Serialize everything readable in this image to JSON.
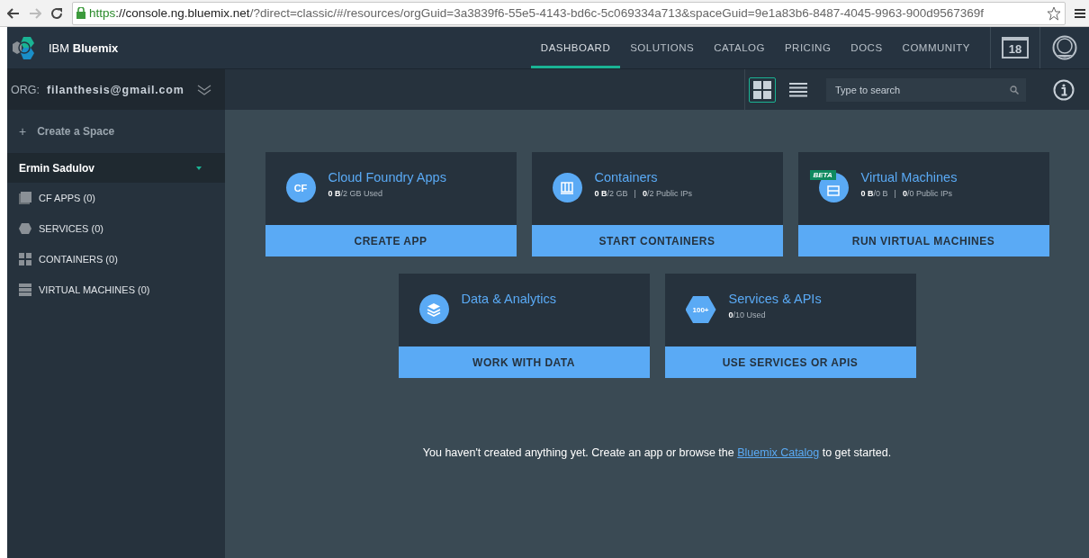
{
  "browser": {
    "url_scheme": "https",
    "url_host": "://console.ng.bluemix.net",
    "url_rest": "/?direct=classic/#/resources/orgGuid=3a3839f6-55e5-4143-bd6c-5c069334a713&spaceGuid=9e1a83b6-8487-4045-9963-900d9567369f"
  },
  "header": {
    "brand_light": "IBM",
    "brand_bold": "Bluemix",
    "nav": [
      {
        "label": "DASHBOARD",
        "selected": true
      },
      {
        "label": "SOLUTIONS",
        "selected": false
      },
      {
        "label": "CATALOG",
        "selected": false
      },
      {
        "label": "PRICING",
        "selected": false
      },
      {
        "label": "DOCS",
        "selected": false
      },
      {
        "label": "COMMUNITY",
        "selected": false
      }
    ],
    "calendar_day": "18"
  },
  "org": {
    "label": "ORG:",
    "value": "filanthesis@gmail.com"
  },
  "toolbar": {
    "views": [
      {
        "kind": "grid",
        "selected": true
      },
      {
        "kind": "list",
        "selected": false
      }
    ],
    "search": {
      "placeholder": "Type to search"
    }
  },
  "sidebar": {
    "create": {
      "icon": "+",
      "label": "Create a Space"
    },
    "space": {
      "name": "Ermin Sadulov",
      "expanded": true
    },
    "items": [
      {
        "kind": "apps",
        "label": "CF APPS (0)"
      },
      {
        "kind": "services",
        "label": "SERVICES (0)"
      },
      {
        "kind": "containers",
        "label": "CONTAINERS (0)"
      },
      {
        "kind": "vms",
        "label": "VIRTUAL MACHINES (0)"
      }
    ]
  },
  "cards": [
    {
      "kind": "cf",
      "icon_text": "CF",
      "title": "Cloud Foundry Apps",
      "stats": [
        "**0 B**/2 GB Used"
      ],
      "action": "CREATE APP"
    },
    {
      "kind": "containers",
      "title": "Containers",
      "stats": [
        "**0 B**/2 GB",
        "**0**/2 Public IPs"
      ],
      "stat_separator": "|",
      "action": "START CONTAINERS"
    },
    {
      "kind": "vm",
      "badge": "BETA",
      "title": "Virtual Machines",
      "stats": [
        "**0 B**/0 B",
        "**0**/0 Public IPs"
      ],
      "stat_separator": "|",
      "action": "RUN VIRTUAL MACHINES"
    },
    {
      "kind": "data",
      "title": "Data & Analytics",
      "action": "WORK WITH DATA"
    },
    {
      "kind": "services",
      "icon_text": "100+",
      "title": "Services & APIs",
      "stats": [
        "**0**/10 Used"
      ],
      "action": "USE SERVICES OR APIS"
    }
  ],
  "message": {
    "before": "You haven't created anything yet. Create an app or browse the",
    "link": "Bluemix Catalog",
    "after": "to get started."
  }
}
